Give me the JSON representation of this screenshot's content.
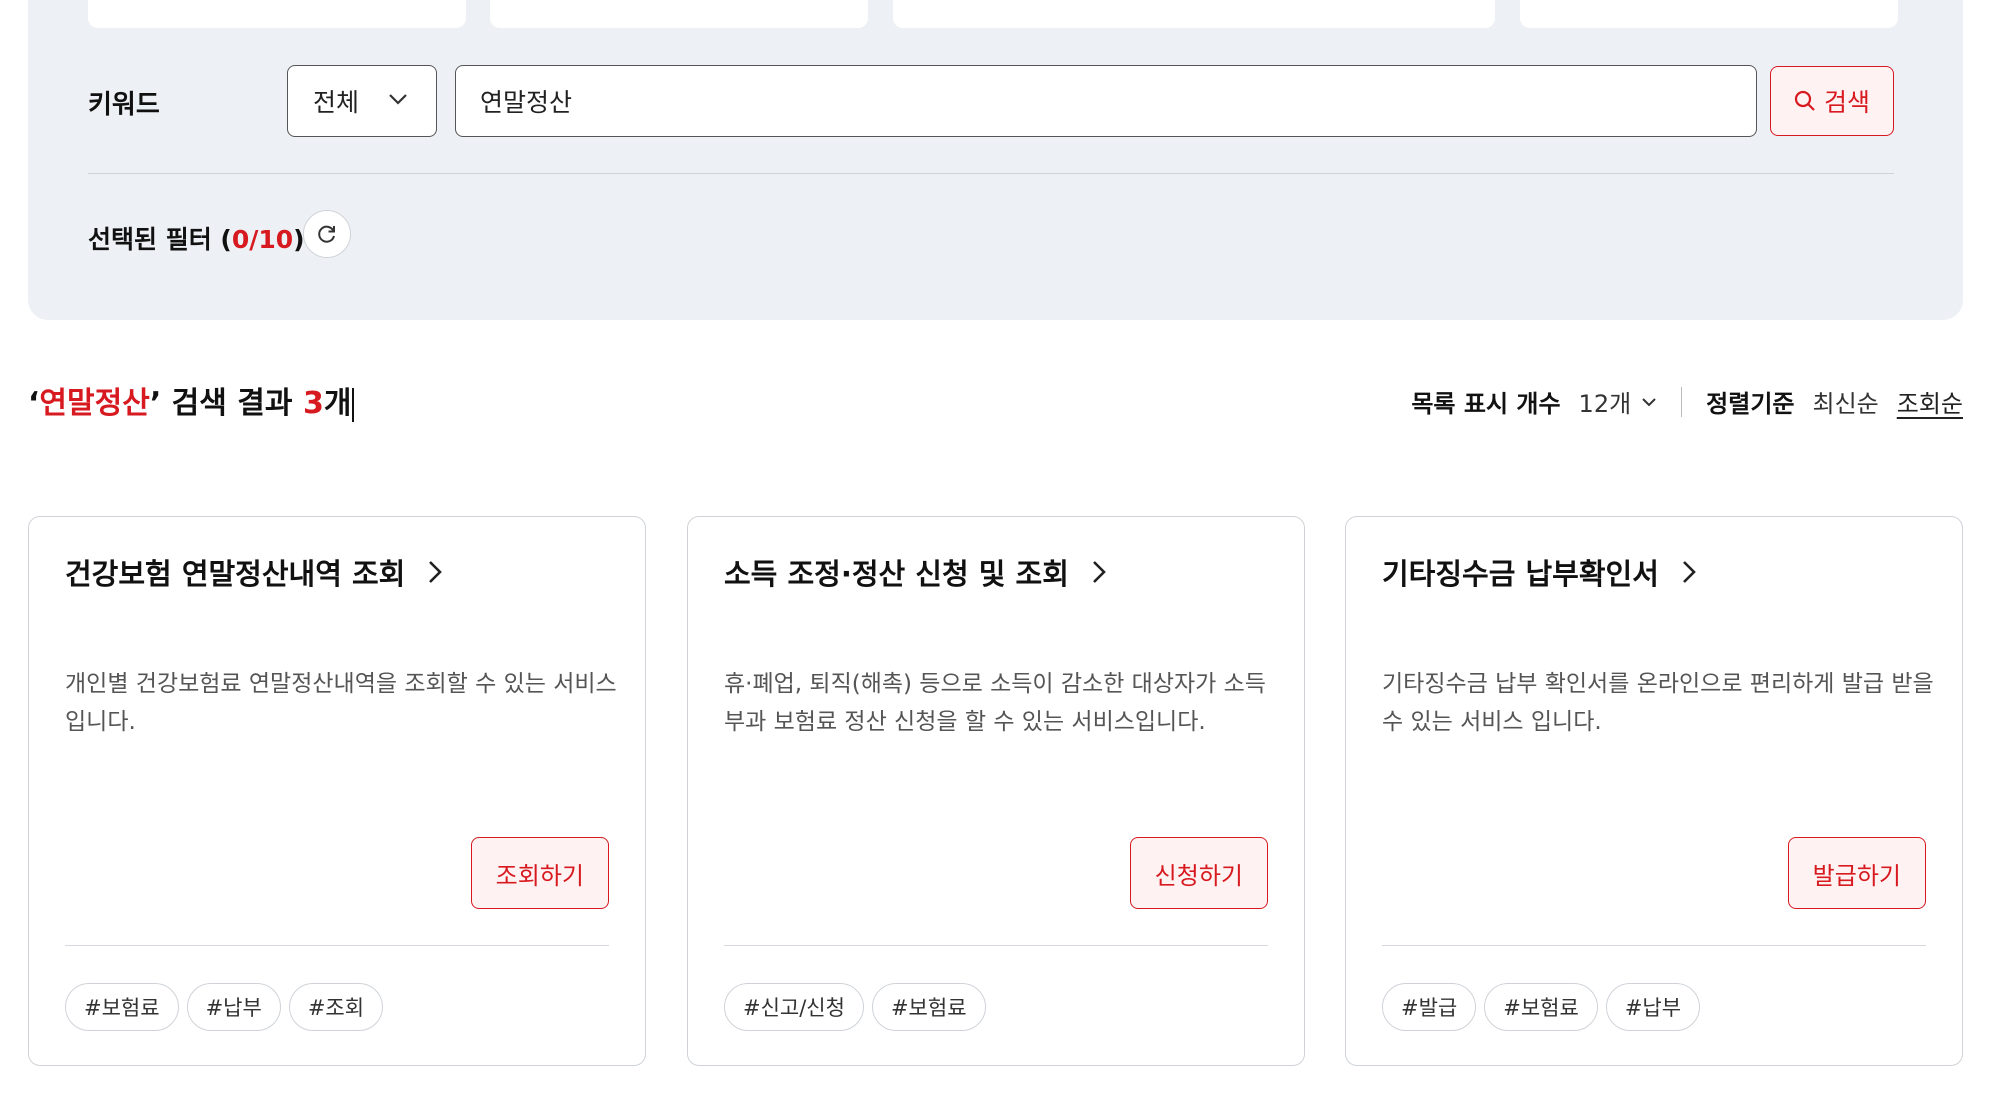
{
  "filter": {
    "keyword_label": "키워드",
    "scope_value": "전체",
    "search_value": "연말정산",
    "search_button": "검색",
    "selected_label": "선택된 필터 (",
    "selected_count": "0/10",
    "selected_close": ")"
  },
  "results": {
    "quote_open": "‘",
    "keyword": "연말정산",
    "quote_close": "’",
    "mid_text": " 검색 결과 ",
    "count": "3",
    "unit": "개"
  },
  "controls": {
    "count_label": "목록 표시 개수",
    "count_value": "12개",
    "sort_label": "정렬기준",
    "sort_options": [
      "최신순",
      "조회순"
    ],
    "active_sort": "조회순"
  },
  "cards": [
    {
      "title": "건강보험 연말정산내역 조회",
      "description": "개인별 건강보험료 연말정산내역을 조회할 수 있는 서비스입니다.",
      "action": "조회하기",
      "tags": [
        "#보험료",
        "#납부",
        "#조회"
      ]
    },
    {
      "title": "소득 조정·정산 신청 및 조회",
      "description": "휴·폐업, 퇴직(해촉) 등으로 소득이 감소한 대상자가 소득 부과 보험료 정산 신청을 할 수 있는 서비스입니다.",
      "action": "신청하기",
      "tags": [
        "#신고/신청",
        "#보험료"
      ]
    },
    {
      "title": "기타징수금 납부확인서",
      "description": "기타징수금 납부 확인서를 온라인으로 편리하게 발급 받을 수 있는 서비스 입니다.",
      "action": "발급하기",
      "tags": [
        "#발급",
        "#보험료",
        "#납부"
      ]
    }
  ],
  "colors": {
    "accent": "#d71920",
    "panel_bg": "#edf0f4"
  },
  "icons": [
    "chevron-down-icon",
    "search-icon",
    "refresh-icon",
    "chevron-right-icon"
  ]
}
